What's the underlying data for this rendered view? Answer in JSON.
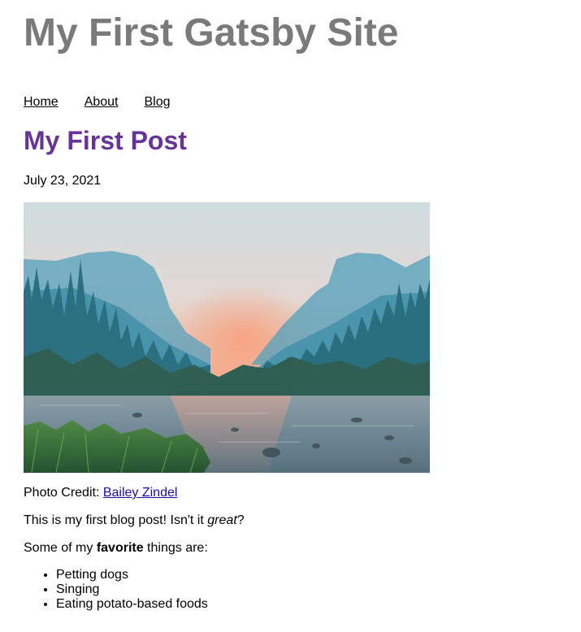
{
  "site": {
    "title": "My First Gatsby Site"
  },
  "nav": {
    "items": [
      {
        "label": "Home"
      },
      {
        "label": "About"
      },
      {
        "label": "Blog"
      }
    ]
  },
  "post": {
    "title": "My First Post",
    "date": "July 23, 2021",
    "credit_prefix": "Photo Credit: ",
    "credit_name": "Bailey Zindel",
    "intro_before": "This is my first blog post! Isn't it ",
    "intro_emphasis": "great",
    "intro_after": "?",
    "favorites_before": "Some of my ",
    "favorites_bold": "favorite",
    "favorites_after": " things are:",
    "favorites": [
      "Petting dogs",
      "Singing",
      "Eating potato-based foods"
    ]
  },
  "colors": {
    "site_title": "#7a7a7a",
    "post_title": "#663399",
    "link": "#1a0dab"
  }
}
